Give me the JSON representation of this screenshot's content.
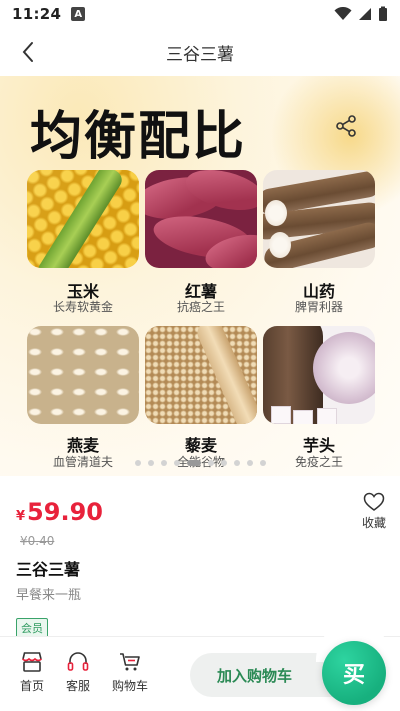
{
  "status_bar": {
    "time": "11:24",
    "notice": "A"
  },
  "nav": {
    "title": "三谷三薯"
  },
  "banner": {
    "heading": "均衡配比",
    "items": [
      {
        "name": "玉米",
        "desc": "长寿软黄金"
      },
      {
        "name": "红薯",
        "desc": "抗癌之王"
      },
      {
        "name": "山药",
        "desc": "脾胃利器"
      },
      {
        "name": "燕麦",
        "desc": "血管清道夫"
      },
      {
        "name": "藜麦",
        "desc": "全能谷物"
      },
      {
        "name": "芋头",
        "desc": "免疫之王"
      }
    ]
  },
  "product": {
    "currency": "¥",
    "price": "59.90",
    "old_price": "¥0.40",
    "name": "三谷三薯",
    "subtitle": "早餐来一瓶",
    "badge": "会员",
    "favorite_label": "收藏"
  },
  "bottom_bar": {
    "home": "首页",
    "service": "客服",
    "cart": "购物车",
    "add_to_cart": "加入购物车",
    "buy": "买"
  },
  "colors": {
    "price": "#e8223b",
    "accent": "#17b07e",
    "cart_text": "#2b8a55"
  }
}
